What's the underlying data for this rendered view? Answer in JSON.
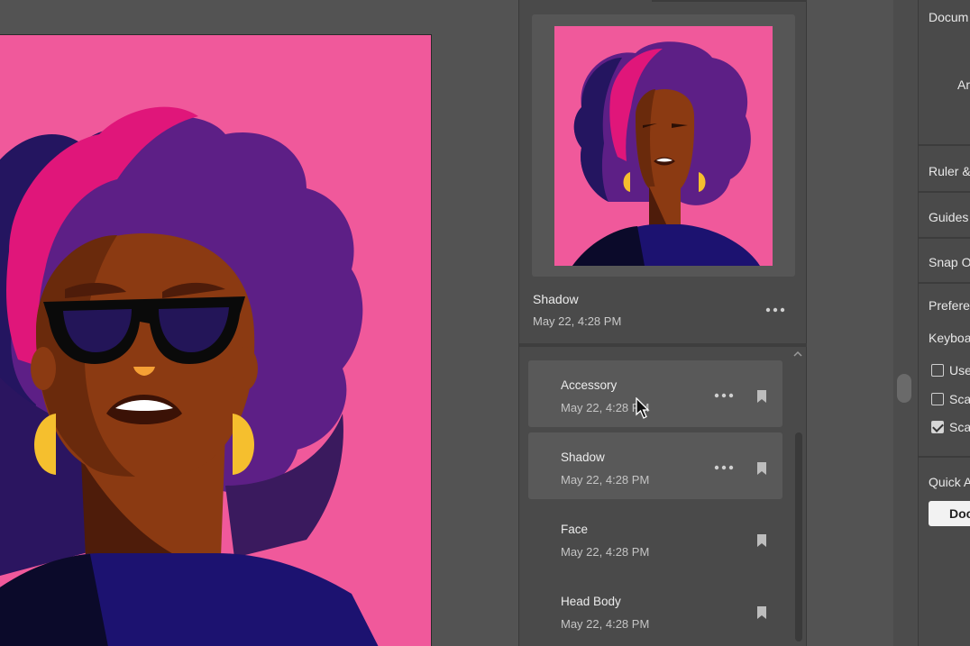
{
  "history": {
    "preview": {
      "title": "Shadow",
      "date": "May 22, 4:28 PM"
    },
    "items": [
      {
        "name": "Accessory",
        "date": "May 22, 4:28 PM",
        "active": true
      },
      {
        "name": "Shadow",
        "date": "May 22, 4:28 PM",
        "active": true
      },
      {
        "name": "Face",
        "date": "May 22, 4:28 PM",
        "active": false
      },
      {
        "name": "Head Body",
        "date": "May 22, 4:28 PM",
        "active": false
      }
    ]
  },
  "properties": {
    "document_label": "Docum",
    "artboard_label": "Ar",
    "ruler_label": "Ruler &",
    "guides_label": "Guides",
    "snap_label": "Snap O",
    "preferences_label": "Prefere",
    "keyboard_label": "Keyboa",
    "checkboxes": [
      {
        "label": "Use",
        "checked": false
      },
      {
        "label": "Sca",
        "checked": false
      },
      {
        "label": "Sca",
        "checked": true
      }
    ],
    "quick_actions_label": "Quick A",
    "document_button_label": "Doc"
  },
  "colors": {
    "artboard_pink": "#f0599b",
    "hair_purple": "#5d1f86",
    "hair_magenta": "#e0167a",
    "hair_navy": "#241560",
    "skin": "#8b3a12",
    "earring": "#f5bf2e"
  },
  "icons": {
    "more": "more-horizontal-icon",
    "bookmark": "bookmark-icon",
    "cursor": "arrow-cursor-icon",
    "scroll_up": "chevron-up-icon"
  }
}
